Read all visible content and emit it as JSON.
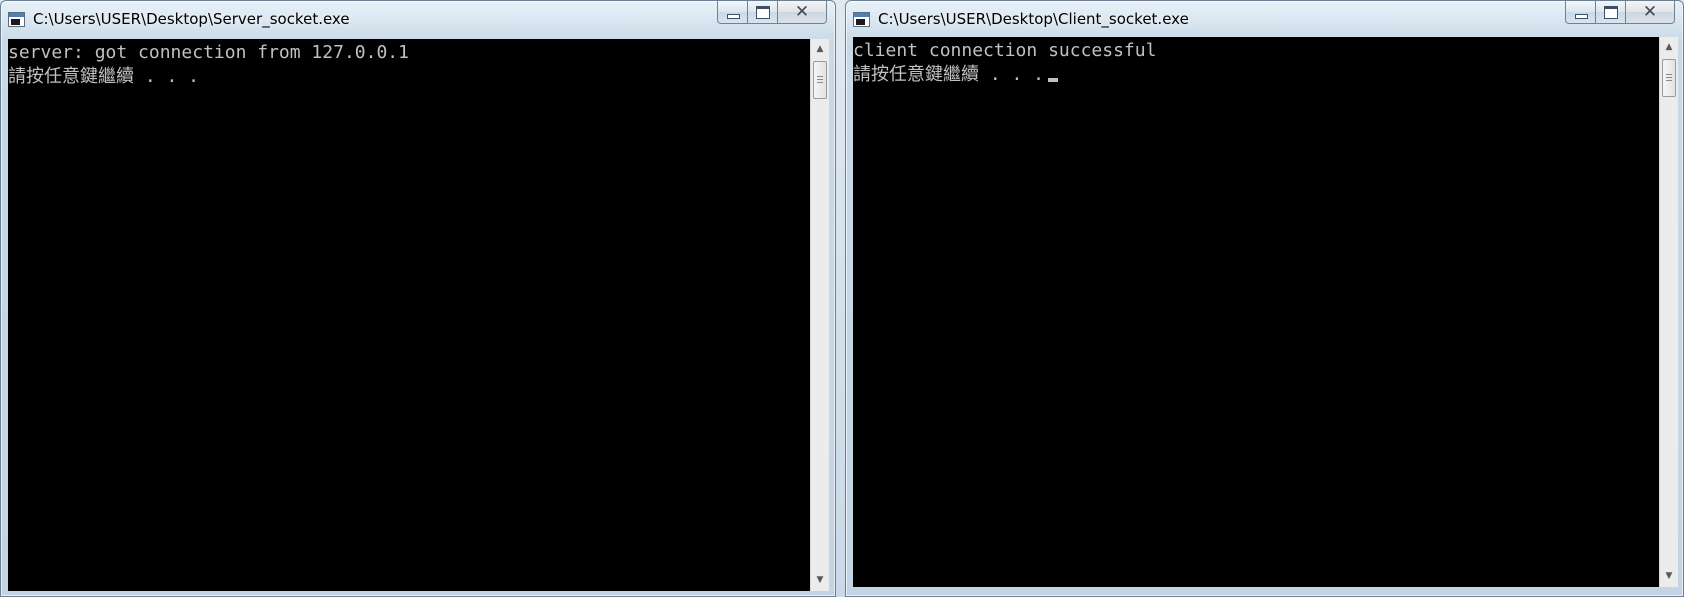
{
  "windows": {
    "server": {
      "title": "C:\\Users\\USER\\Desktop\\Server_socket.exe",
      "lines": [
        "server: got connection from 127.0.0.1",
        "請按任意鍵繼續 . . ."
      ]
    },
    "client": {
      "title": "C:\\Users\\USER\\Desktop\\Client_socket.exe",
      "lines": [
        "client connection successful",
        "請按任意鍵繼續 . . ."
      ]
    }
  },
  "icons": {
    "window_icon": "console-window-icon",
    "minimize": "minimize-icon",
    "maximize": "maximize-icon",
    "close": "close-icon",
    "scroll_up": "scroll-up-arrow-icon",
    "scroll_down": "scroll-down-arrow-icon"
  },
  "glyphs": {
    "close": "✕",
    "scroll_up": "▲",
    "scroll_down": "▼"
  },
  "colors": {
    "console_background": "#000000",
    "console_text": "#c0c0c0",
    "frame": "#c9d9e6"
  }
}
